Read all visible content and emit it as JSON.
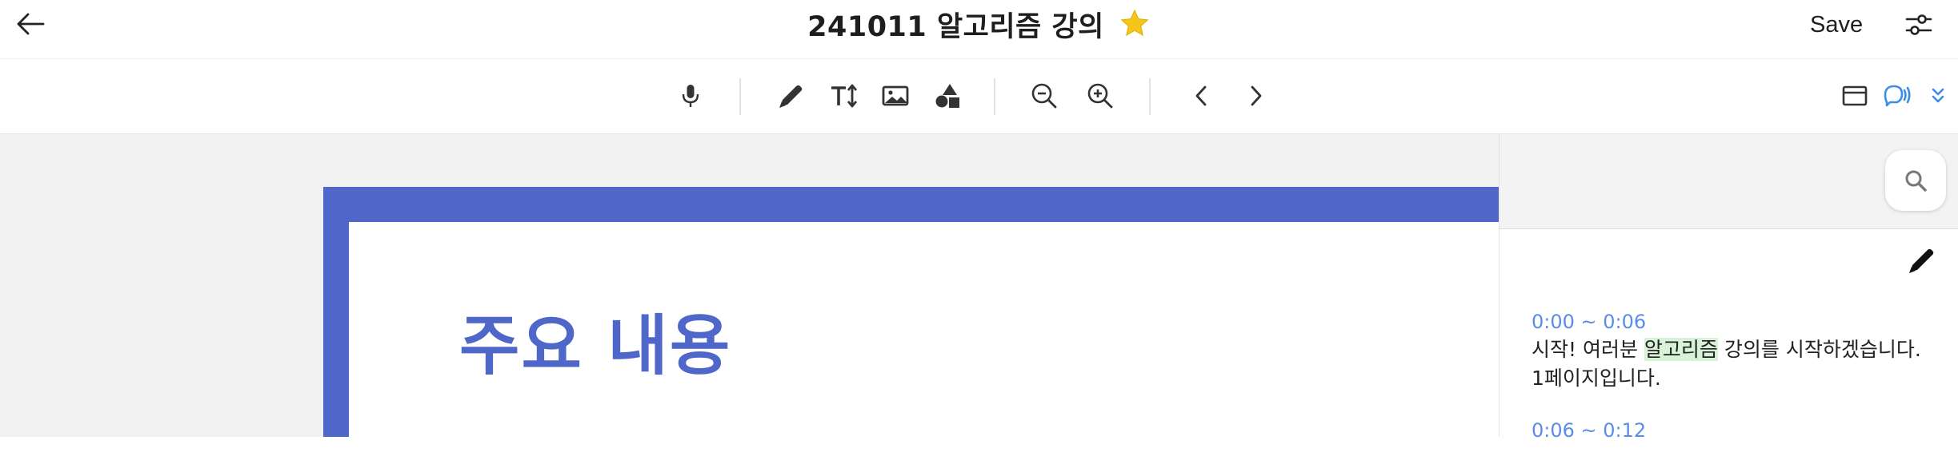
{
  "header": {
    "title": "241011 알고리즘 강의",
    "save_label": "Save",
    "back_icon": "arrow-left-icon",
    "star_icon": "star-icon",
    "settings_icon": "sliders-icon",
    "star_color": "#f5c518"
  },
  "toolbar": {
    "icons": [
      "microphone-icon",
      "pen-icon",
      "text-size-icon",
      "image-icon",
      "shapes-icon",
      "zoom-out-icon",
      "zoom-in-icon",
      "chevron-left-icon",
      "chevron-right-icon",
      "window-icon",
      "speech-icon",
      "double-chevron-down-icon"
    ],
    "accent_color": "#3a8ee6"
  },
  "slide": {
    "heading": "주요 내용",
    "accent_color": "#4f67c9"
  },
  "transcript": {
    "entries": [
      {
        "time": "0:00 ~ 0:06",
        "text_before": "시작! 여러분 ",
        "highlight": "알고리즘",
        "text_after": " 강의를 시작하겠습니다. 1페이지입니다."
      },
      {
        "time": "0:06 ~ 0:12"
      }
    ],
    "highlight_color": "#d8f2d8",
    "time_color": "#5b8de8"
  }
}
